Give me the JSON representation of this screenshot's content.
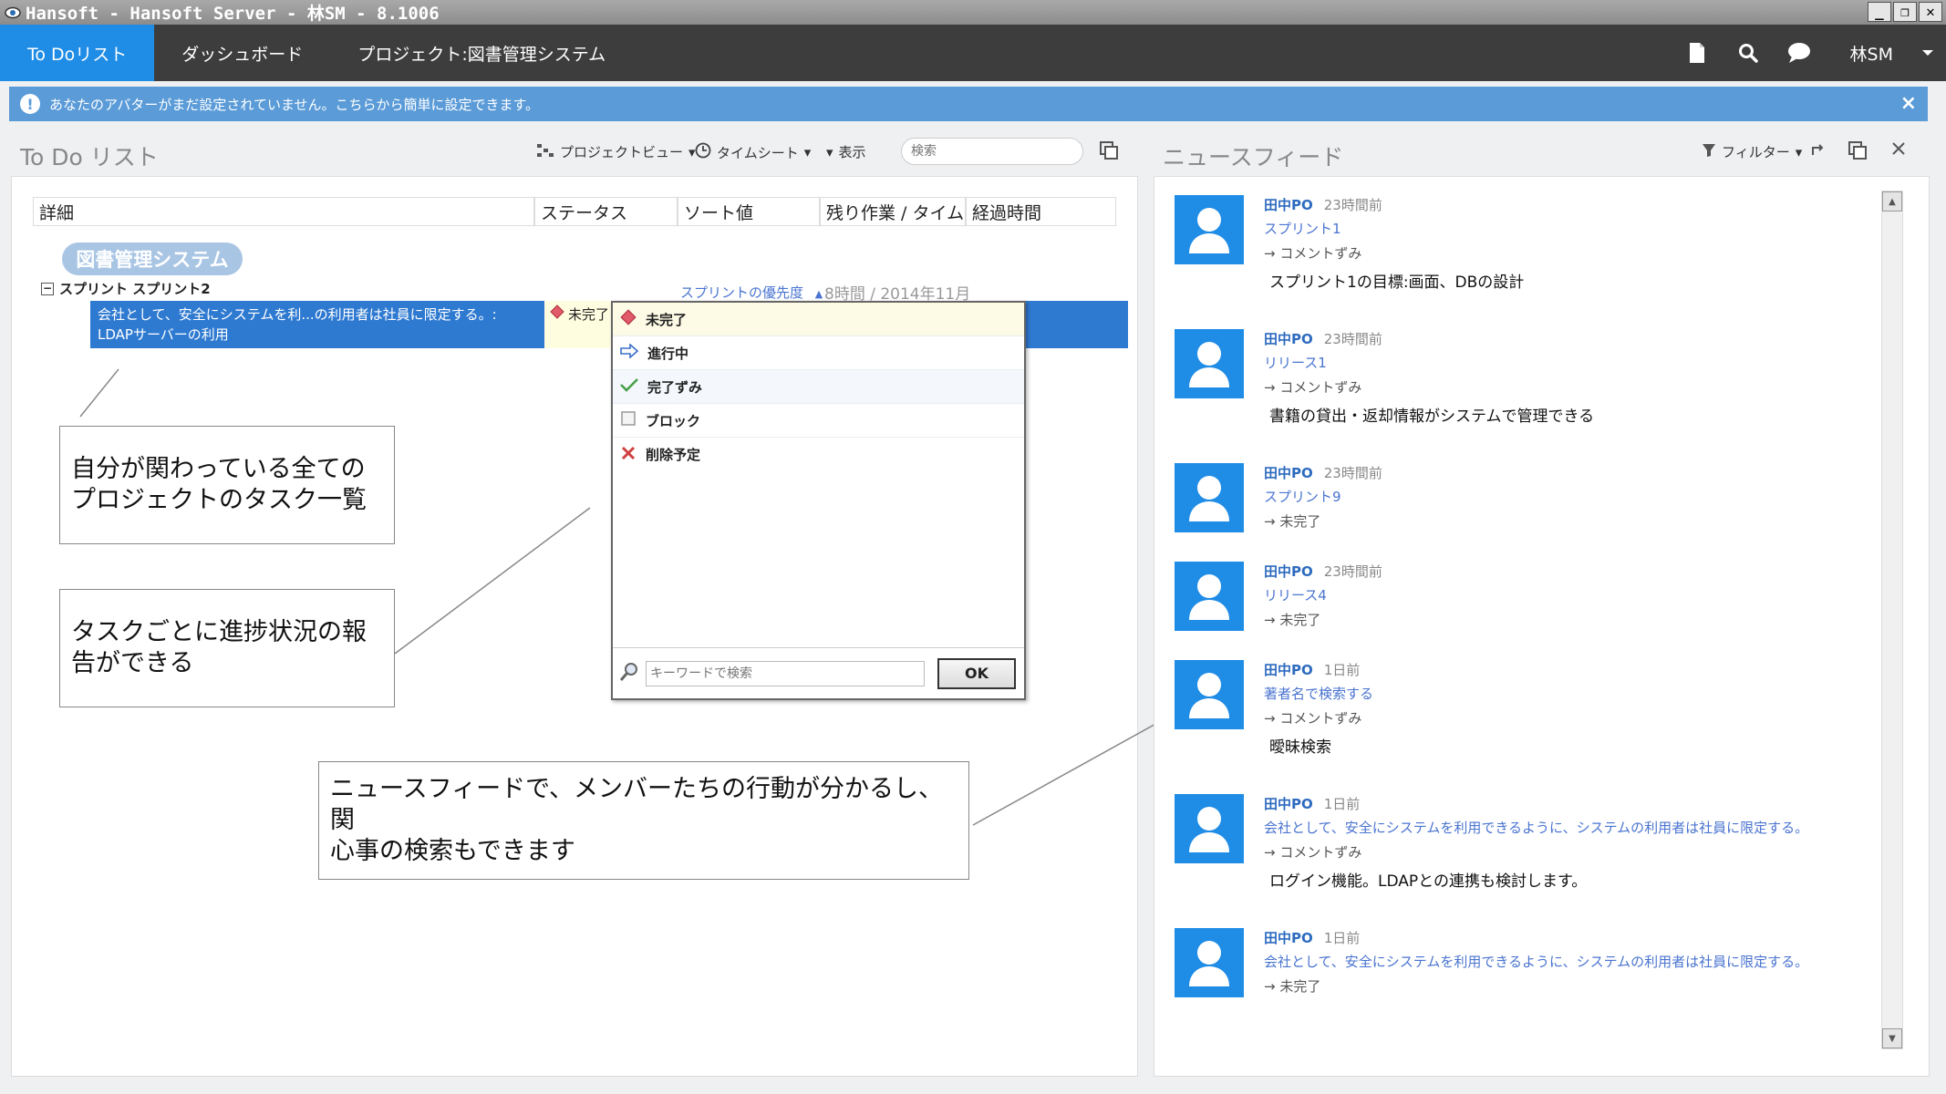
{
  "window": {
    "title": "Hansoft - Hansoft Server - 林SM - 8.1006",
    "buttons": [
      "_",
      "❐",
      "✕"
    ]
  },
  "nav": {
    "tabs": [
      {
        "label": "To Doリスト",
        "active": true
      },
      {
        "label": "ダッシュボード",
        "active": false
      },
      {
        "label": "プロジェクト:図書管理システム",
        "active": false
      }
    ],
    "user": "林SM"
  },
  "alert": {
    "text": "あなたのアバターがまだ設定されていません。こちらから簡単に設定できます。",
    "close": "×"
  },
  "todo": {
    "title": "To Do リスト",
    "toolbar": {
      "project_view": "プロジェクトビュー",
      "timesheet": "タイムシート",
      "display": "表示",
      "search_placeholder": "検索"
    },
    "columns": [
      "詳細",
      "ステータス",
      "ソート値",
      "残り作業 / タイムライン",
      "経過時間"
    ],
    "project": "図書管理システム",
    "sprint": {
      "toggle": "−",
      "label": "スプリント スプリント2",
      "sort": "スプリントの優先度",
      "sort_arrow": "▲",
      "remaining": "8時間 / 2014年11月"
    },
    "task": {
      "text": "会社として、安全にシステムを利...の利用者は社員に限定する。: LDAPサーバーの利用",
      "status": "未完了"
    }
  },
  "status_menu": {
    "items": [
      {
        "label": "未完了",
        "icon": "diamond-icon"
      },
      {
        "label": "進行中",
        "icon": "arrow-right-icon"
      },
      {
        "label": "完了ずみ",
        "icon": "check-icon"
      },
      {
        "label": "ブロック",
        "icon": "square-icon"
      },
      {
        "label": "削除予定",
        "icon": "x-icon"
      }
    ],
    "search_placeholder": "キーワードで検索",
    "ok": "OK"
  },
  "callouts": [
    {
      "lines": [
        "自分が関わっている全ての",
        "プロジェクトのタスク一覧"
      ]
    },
    {
      "lines": [
        "タスクごとに進捗状況の報",
        "告ができる"
      ]
    },
    {
      "lines": [
        "ニュースフィードで、メンバーたちの行動が分かるし、関",
        "心事の検索もできます"
      ]
    }
  ],
  "news": {
    "title": "ニュースフィード",
    "filter": "フィルター",
    "items": [
      {
        "author": "田中PO",
        "time": "23時間前",
        "target": "スプリント1",
        "action": "→ コメントずみ",
        "comment": "スプリント1の目標:画面、DBの設計"
      },
      {
        "author": "田中PO",
        "time": "23時間前",
        "target": "リリース1",
        "action": "→ コメントずみ",
        "comment": "書籍の貸出・返却情報がシステムで管理できる"
      },
      {
        "author": "田中PO",
        "time": "23時間前",
        "target": "スプリント9",
        "action": "→ 未完了",
        "comment": ""
      },
      {
        "author": "田中PO",
        "time": "23時間前",
        "target": "リリース4",
        "action": "→ 未完了",
        "comment": ""
      },
      {
        "author": "田中PO",
        "time": "1日前",
        "target": "著者名で検索する",
        "action": "→ コメントずみ",
        "comment": "曖昧検索"
      },
      {
        "author": "田中PO",
        "time": "1日前",
        "target": "会社として、安全にシステムを利用できるように、システムの利用者は社員に限定する。",
        "action": "→ コメントずみ",
        "comment": "ログイン機能。LDAPとの連携も検討します。"
      },
      {
        "author": "田中PO",
        "time": "1日前",
        "target": "会社として、安全にシステムを利用できるように、システムの利用者は社員に限定する。",
        "action": "→ 未完了",
        "comment": ""
      }
    ]
  },
  "colors": {
    "accent": "#1f8ce6",
    "nav_bg": "#3d3d3d",
    "alert_bg": "#5a9bd8",
    "selection": "#2f7ad1"
  }
}
